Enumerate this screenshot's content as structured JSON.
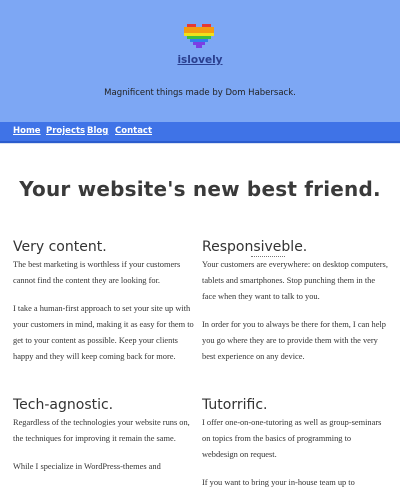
{
  "site": {
    "brand": "islovely",
    "tagline": "Magnificent things made by Dom Habersack."
  },
  "nav": {
    "items": [
      "Home",
      "Projects",
      "Blog",
      "Contact"
    ]
  },
  "hero": {
    "title": "Your website's new best friend."
  },
  "sections": {
    "content": {
      "title": "Very content.",
      "p1": "The best marketing is worthless if your customers cannot find the content they are looking for.",
      "p2": "I take a human-first approach to set your site up with your customers in mind, making it as easy for them to get to your content as possible. Keep your clients happy and they will keep coming back for more."
    },
    "responsive": {
      "title": "Responsiveble.",
      "p1": "Your customers are everywhere: on desktop computers, tablets and smartphones. Stop punching them in the face when they want to talk to you.",
      "p2": "In order for you to always be there for them, I can help you go where they are to provide them with the very best experience on any device."
    },
    "agnostic": {
      "title": "Tech-agnostic.",
      "p1": "Regardless of the technologies your website runs on, the techniques for improving it remain the same.",
      "p2": "While I specialize in WordPress-themes and"
    },
    "tutorific": {
      "title": "Tutorrific.",
      "p1": "I offer one-on-one-tutoring as well as group-seminars on topics from the basics of programming to webdesign on request.",
      "p2": "If you want to bring your in-house team up to"
    }
  }
}
